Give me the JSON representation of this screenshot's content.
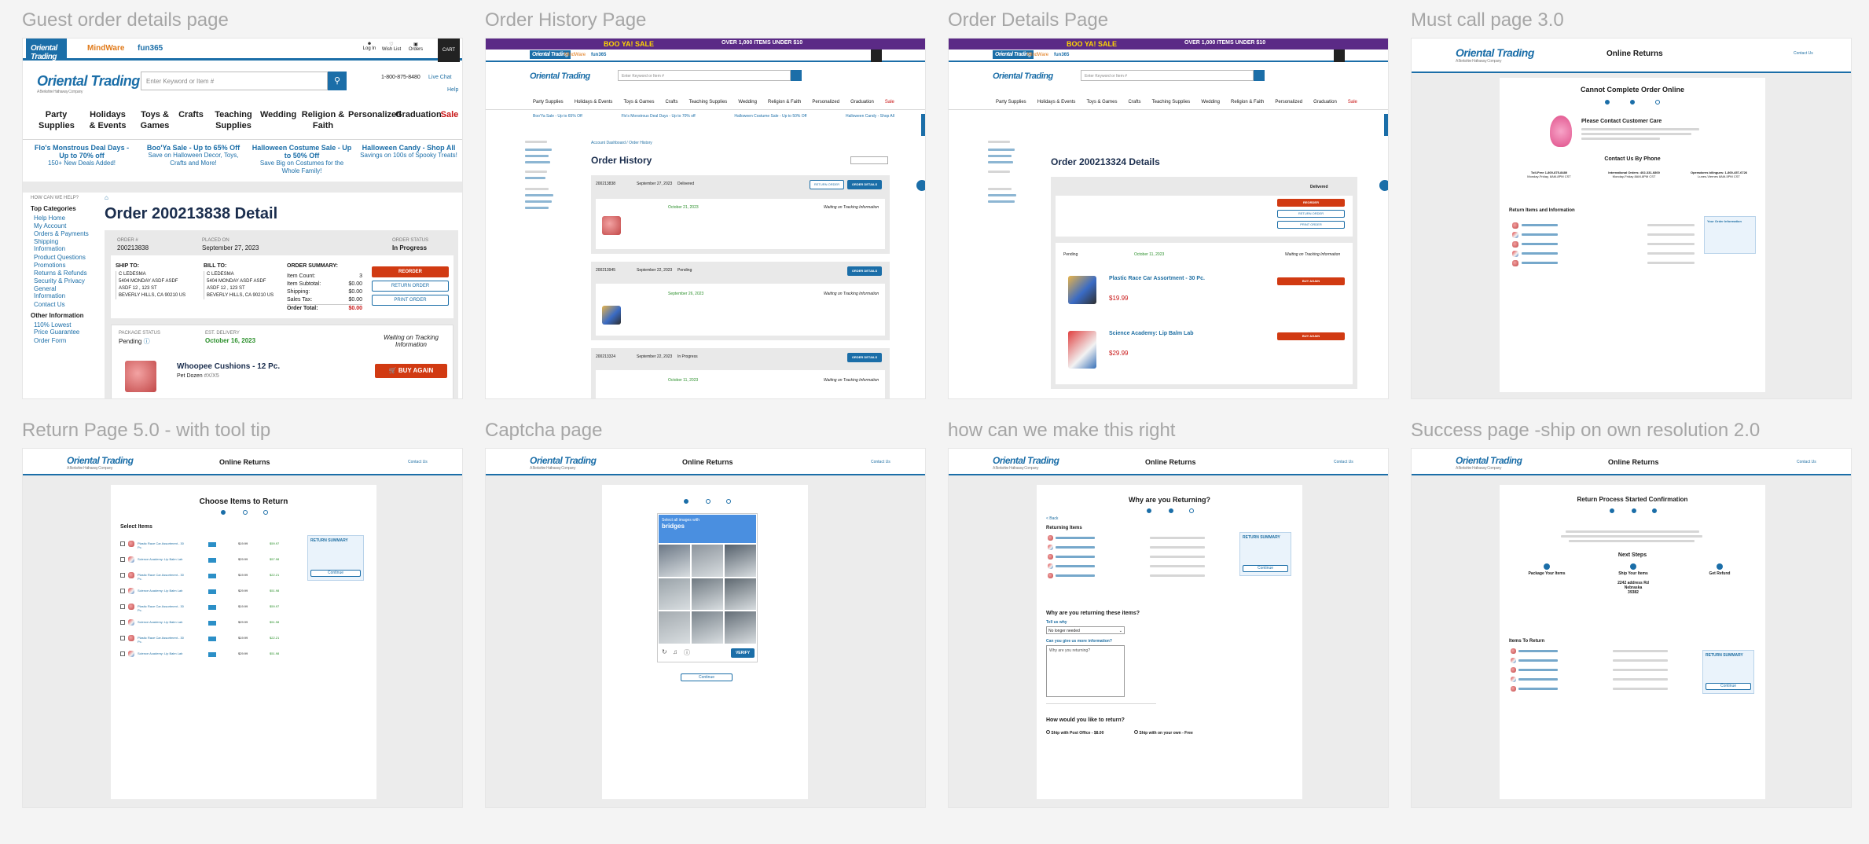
{
  "frames": {
    "f1": "Guest order details page",
    "f2": "Order History Page",
    "f3": "Order Details Page",
    "f4": "Must call page 3.0",
    "f5": "Return Page 5.0 - with tool tip",
    "f6": "Captcha page",
    "f7": "how can we make this right",
    "f8": "Success page -ship on own resolution 2.0"
  },
  "f1": {
    "logo": "Oriental Trading",
    "logo_sub": "A Berkshire Hathaway Company",
    "tab2": "MindWare",
    "tab3": "fun365",
    "top_links": [
      "Log In",
      "Wish List",
      "Orders"
    ],
    "cart": "CART",
    "search_placeholder": "Enter Keyword or Item #",
    "phone": "1-800-875-8480",
    "live_chat": "Live Chat",
    "help": "Help",
    "nav": [
      "Party Supplies",
      "Holidays & Events",
      "Toys & Games",
      "Crafts",
      "Teaching Supplies",
      "Wedding",
      "Religion & Faith",
      "Personalized",
      "Graduation",
      "Sale"
    ],
    "promos": [
      {
        "title": "Flo's Monstrous Deal Days - Up to 70% off",
        "sub": "150+ New Deals Added!"
      },
      {
        "title": "Boo'Ya Sale - Up to 65% Off",
        "sub": "Save on Halloween Decor, Toys, Crafts and More!"
      },
      {
        "title": "Halloween Costume Sale - Up to 50% Off",
        "sub": "Save Big on Costumes for the Whole Family!"
      },
      {
        "title": "Halloween Candy - Shop All",
        "sub": "Savings on 100s of Spooky Treats!"
      }
    ],
    "help_label": "HOW CAN WE HELP?",
    "top_categories": "Top Categories",
    "cat_links": [
      "Help Home",
      "My Account",
      "Orders & Payments",
      "Shipping Information",
      "Product Questions",
      "Promotions",
      "Returns & Refunds",
      "Security & Privacy",
      "General Information",
      "Contact Us"
    ],
    "other_info": "Other Information",
    "other_links": [
      "110% Lowest Price Guarantee",
      "Order Form"
    ],
    "heading": "Order 200213838 Detail",
    "order_label": "ORDER #",
    "order_no": "200213838",
    "placed_label": "PLACED ON",
    "placed": "September 27, 2023",
    "status_label": "ORDER STATUS",
    "status": "In Progress",
    "ship_to": "SHIP TO:",
    "bill_to": "BILL TO:",
    "addr": [
      "C LEDESMA",
      "5404 MONDAY ASDF ASDF",
      "ASDF 12 , 123 ST",
      "BEVERLY HILLS, CA 90210 US"
    ],
    "summary_label": "ORDER SUMMARY:",
    "summary": [
      [
        "Item Count:",
        "3"
      ],
      [
        "Item Subtotal:",
        "$0.00"
      ],
      [
        "Shipping:",
        "$0.00"
      ],
      [
        "Sales Tax:",
        "$0.00"
      ]
    ],
    "order_total_label": "Order Total:",
    "order_total": "$0.00",
    "reorder": "REORDER",
    "return_order": "RETURN ORDER",
    "print_order": "PRINT ORDER",
    "pkg_status_label": "PACKAGE STATUS",
    "pkg_status": "Pending",
    "est_label": "EST. DELIVERY",
    "est": "October 16, 2023",
    "waiting": "Waiting on Tracking Information",
    "item_name": "Whoopee Cushions - 12 Pc.",
    "item_brand": "Pet Dozen",
    "item_no": "#X/X5",
    "buy_again": "BUY AGAIN"
  },
  "f2": {
    "banner": "BOO YA! SALE",
    "banner_right": "OVER 1,000 ITEMS UNDER $10",
    "heading": "Order History",
    "breadcrumb": "Account Dashboard / Order History",
    "orders": [
      {
        "no": "200213838",
        "date": "September 27, 2023",
        "status": "Delivered",
        "est": "October 21, 2023"
      },
      {
        "no": "200213945",
        "date": "September 22, 2023",
        "status": "Pending",
        "est": "September 26, 2023"
      },
      {
        "no": "200213324",
        "date": "September 22, 2023",
        "status": "In Progress",
        "est": "October 11, 2023"
      }
    ],
    "return_order": "RETURN ORDER",
    "order_details": "ORDER DETAILS",
    "waiting": "Waiting on Tracking Information"
  },
  "f3": {
    "heading": "Order 200213324 Details",
    "reorder": "REORDER",
    "return_order": "RETURN ORDER",
    "print_order": "PRINT ORDER",
    "status": "Delivered",
    "pending": "Pending",
    "est": "October 11, 2023",
    "waiting": "Waiting on Tracking Information",
    "items": [
      {
        "name": "Plastic Race Car Assortment - 30 Pc.",
        "price": "$19.99"
      },
      {
        "name": "Science Academy: Lip Balm Lab",
        "price": "$29.99"
      }
    ],
    "buy_again": "BUY AGAIN"
  },
  "f4": {
    "header_title": "Online Returns",
    "contact": "Contact Us",
    "heading": "Cannot Complete Order Online",
    "please": "Please Contact Customer Care",
    "contact_by_phone": "Contact Us By Phone",
    "phones": [
      {
        "label": "Toll-Free 1-800-875-8480",
        "hours": "Monday-Friday, 8AM-8PM CST"
      },
      {
        "label": "International Orders: 402-331-6800",
        "hours": "Monday-Friday 8AM-8PM CST"
      },
      {
        "label": "Operadores bilingues: 1-800-457-6726",
        "hours": "Lunes-Viernes 8AM-5PM CST"
      }
    ],
    "return_items": "Return Items and Information",
    "your_info": "Your Order Information"
  },
  "f5": {
    "heading": "Choose Items to Return",
    "select_items": "Select Items",
    "return_summary": "RETURN SUMMARY",
    "continue": "Continue",
    "rows": [
      {
        "name": "Plastic Race Car Assortment - 30 Pc.",
        "price": "$19.99",
        "total": "$59.97"
      },
      {
        "name": "Science Academy: Lip Balm Lab",
        "price": "$29.99",
        "total": "$57.98"
      },
      {
        "name": "Plastic Race Car Assortment - 30 Pc.",
        "price": "$19.99",
        "total": "$22.21"
      },
      {
        "name": "Science Academy: Lip Balm Lab",
        "price": "$29.99",
        "total": "$51.98"
      },
      {
        "name": "Plastic Race Car Assortment - 30 Pc.",
        "price": "$19.99",
        "total": "$59.97"
      },
      {
        "name": "Science Academy: Lip Balm Lab",
        "price": "$29.99",
        "total": "$51.98"
      },
      {
        "name": "Plastic Race Car Assortment - 30 Pc.",
        "price": "$19.99",
        "total": "$22.21"
      },
      {
        "name": "Science Academy: Lip Balm Lab",
        "price": "$29.99",
        "total": "$51.98"
      }
    ]
  },
  "f6": {
    "header_title": "Online Returns",
    "captcha_prompt": "Select all images with",
    "captcha_word": "bridges",
    "verify": "VERIFY",
    "continue": "Continue"
  },
  "f7": {
    "header_title": "Online Returns",
    "heading": "Why are you Returning?",
    "back": "< Back",
    "returning_items": "Returning Items",
    "why_returning": "Why are you returning these items?",
    "tell_us": "Tell us why",
    "reason": "No longer needed",
    "more_info": "Can you give us more information?",
    "textarea_ph": "Why are you returning?",
    "how_return": "How would you like to return?",
    "opt1": "Ship with Post Office - $8.00",
    "opt2": "Ship with on your own - Free",
    "return_summary": "RETURN SUMMARY",
    "continue": "Continue"
  },
  "f8": {
    "header_title": "Online Returns",
    "heading": "Return Process Started Confirmation",
    "next_steps": "Next Steps",
    "steps": [
      "Package Your Items",
      "Ship Your Items",
      "Get Refund"
    ],
    "address": [
      "2242 address Rd",
      "Nebraska",
      "39382"
    ],
    "items_to_return": "Items To Return",
    "return_summary": "RETURN SUMMARY",
    "continue": "Continue"
  },
  "colors": {
    "brand": "#1b6ea8",
    "cta": "#d13a12",
    "purple": "#5b2a86"
  }
}
